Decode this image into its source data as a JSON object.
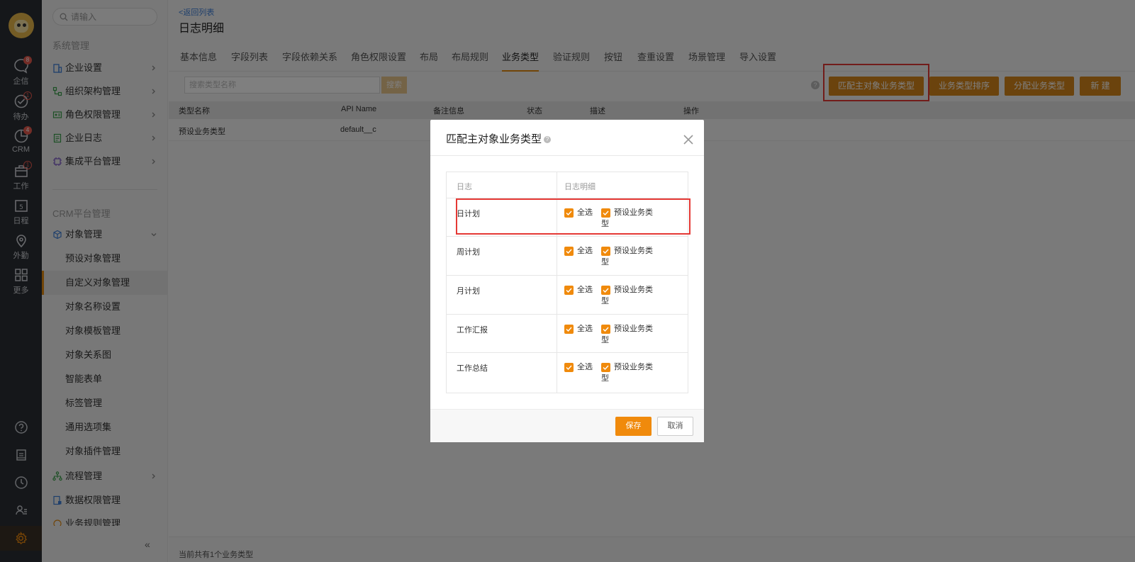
{
  "rail": {
    "items": [
      {
        "label": "企信",
        "badge": "8"
      },
      {
        "label": "待办",
        "badge": "1"
      },
      {
        "label": "CRM",
        "badge": "4"
      },
      {
        "label": "工作",
        "badge": "1"
      },
      {
        "label": "日程",
        "icon_text": "5"
      },
      {
        "label": "外勤"
      },
      {
        "label": "更多"
      }
    ]
  },
  "sidebar": {
    "search_placeholder": "请输入",
    "section_system": "系统管理",
    "section_crm": "CRM平台管理",
    "system_items": [
      "企业设置",
      "组织架构管理",
      "角色权限管理",
      "企业日志",
      "集成平台管理"
    ],
    "object_mgmt": "对象管理",
    "object_sub_items": [
      "预设对象管理",
      "自定义对象管理",
      "对象名称设置",
      "对象模板管理",
      "对象关系图",
      "智能表单",
      "标签管理",
      "通用选项集",
      "对象插件管理"
    ],
    "bottom_items": [
      "流程管理",
      "数据权限管理",
      "业务规则管理"
    ],
    "collapse_glyph": "«"
  },
  "main": {
    "back_link": "<返回列表",
    "title": "日志明细",
    "tabs": [
      "基本信息",
      "字段列表",
      "字段依赖关系",
      "角色权限设置",
      "布局",
      "布局规则",
      "业务类型",
      "验证规则",
      "按钮",
      "查重设置",
      "场景管理",
      "导入设置"
    ],
    "toolbar": {
      "search_placeholder": "搜索类型名称",
      "search_button": "搜索",
      "help_glyph": "?",
      "match_button": "匹配主对象业务类型",
      "sort_button": "业务类型排序",
      "assign_button": "分配业务类型",
      "new_button": "新 建"
    },
    "columns": [
      "类型名称",
      "API Name",
      "备注信息",
      "状态",
      "描述",
      "操作"
    ],
    "rows": [
      {
        "name": "预设业务类型",
        "api": "default__c"
      }
    ],
    "footer": "当前共有1个业务类型"
  },
  "modal": {
    "title": "匹配主对象业务类型",
    "help_glyph": "?",
    "col_left": "日志",
    "col_right": "日志明细",
    "select_all": "全选",
    "type_label": "预设业务类",
    "type_label_wrap": "型",
    "rows": [
      "日计划",
      "周计划",
      "月计划",
      "工作汇报",
      "工作总结"
    ],
    "save": "保存",
    "cancel": "取消"
  },
  "colors": {
    "accent": "#f08a0c",
    "toolbar_button": "#d6861a",
    "highlight": "#e53935",
    "rail_bg": "#2b2f35"
  }
}
